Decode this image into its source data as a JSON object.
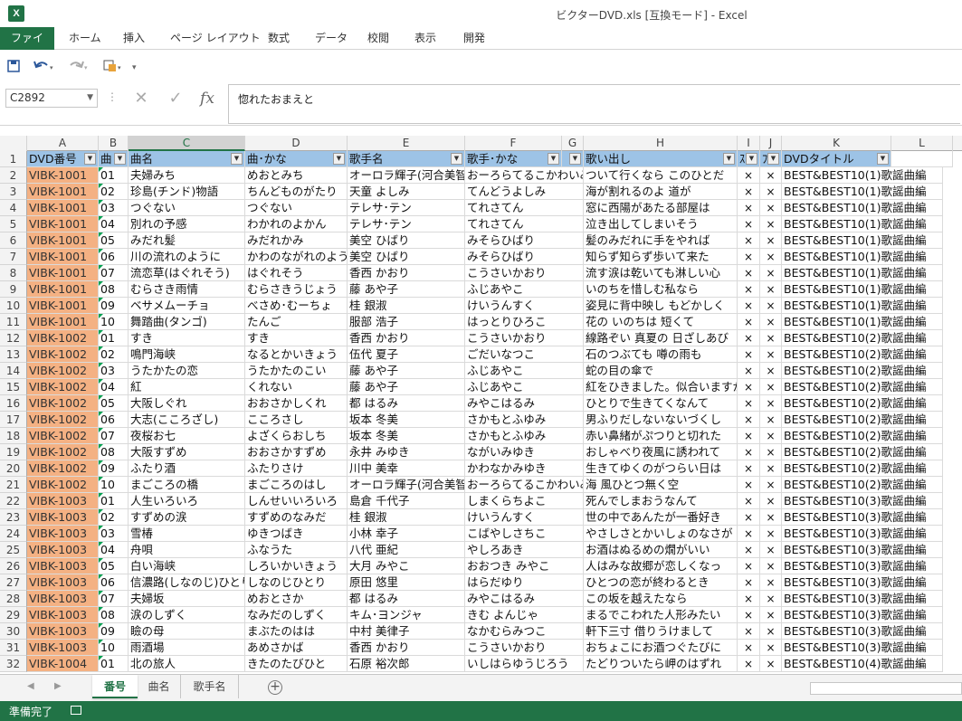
{
  "window": {
    "title": "ビクターDVD.xls  [互換モード] - Excel",
    "app_icon": "X"
  },
  "ribbon": {
    "tabs": [
      "ファイル",
      "ホーム",
      "挿入",
      "ページ レイアウト",
      "数式",
      "データ",
      "校閲",
      "表示",
      "開発"
    ]
  },
  "qat": {
    "icons": [
      "save-icon",
      "undo-icon",
      "redo-icon",
      "format-painter-icon",
      "customize-icon"
    ]
  },
  "formula_bar": {
    "name_box": "C2892",
    "formula": "惚れたおまえと",
    "fx_label": "fx"
  },
  "grid": {
    "columns": [
      "A",
      "B",
      "C",
      "D",
      "E",
      "F",
      "G",
      "H",
      "I",
      "J",
      "K",
      "L",
      "M"
    ],
    "selected_column": "C",
    "header_row": [
      "DVD番号",
      "曲",
      "曲名",
      "曲･かな",
      "歌手名",
      "歌手･かな",
      "",
      "歌い出し",
      "ｽ",
      "ﾌ",
      "DVDタイトル",
      ""
    ],
    "rows": [
      [
        "VIBK-1001",
        "01",
        "夫婦みち",
        "めおとみち",
        "オーロラ輝子(河合美智子)",
        "おーろらてるこかわいみちこ",
        "ついて行くなら このひとだ",
        "×",
        "×",
        "BEST&BEST10(1)歌謡曲編"
      ],
      [
        "VIBK-1001",
        "02",
        "珍島(チンド)物語",
        "ちんどものがたり",
        "天童 よしみ",
        "てんどうよしみ",
        "海が割れるのよ 道が",
        "×",
        "×",
        "BEST&BEST10(1)歌謡曲編"
      ],
      [
        "VIBK-1001",
        "03",
        "つぐない",
        "つぐない",
        "テレサ･テン",
        "てれさてん",
        "窓に西陽があたる部屋は",
        "×",
        "×",
        "BEST&BEST10(1)歌謡曲編"
      ],
      [
        "VIBK-1001",
        "04",
        "別れの予感",
        "わかれのよかん",
        "テレサ･テン",
        "てれさてん",
        "泣き出してしまいそう",
        "×",
        "×",
        "BEST&BEST10(1)歌謡曲編"
      ],
      [
        "VIBK-1001",
        "05",
        "みだれ髪",
        "みだれかみ",
        "美空 ひばり",
        "みそらひばり",
        "髪のみだれに手をやれば",
        "×",
        "×",
        "BEST&BEST10(1)歌謡曲編"
      ],
      [
        "VIBK-1001",
        "06",
        "川の流れのように",
        "かわのながれのように",
        "美空 ひばり",
        "みそらひばり",
        "知らず知らず歩いて来た",
        "×",
        "×",
        "BEST&BEST10(1)歌謡曲編"
      ],
      [
        "VIBK-1001",
        "07",
        "流恋草(はぐれそう)",
        "はぐれそう",
        "香西 かおり",
        "こうさいかおり",
        "流す涙は乾いても淋しい心",
        "×",
        "×",
        "BEST&BEST10(1)歌謡曲編"
      ],
      [
        "VIBK-1001",
        "08",
        "むらさき雨情",
        "むらさきうじょう",
        "藤 あや子",
        "ふじあやこ",
        "いのちを惜しむ私なら",
        "×",
        "×",
        "BEST&BEST10(1)歌謡曲編"
      ],
      [
        "VIBK-1001",
        "09",
        "ベサメムーチョ",
        "べさめ･むーちょ",
        "桂 銀淑",
        "けいうんすく",
        "姿見に背中映し もどかしく",
        "×",
        "×",
        "BEST&BEST10(1)歌謡曲編"
      ],
      [
        "VIBK-1001",
        "10",
        "舞踏曲(タンゴ)",
        "たんご",
        "服部 浩子",
        "はっとりひろこ",
        "花の いのちは 短くて",
        "×",
        "×",
        "BEST&BEST10(1)歌謡曲編"
      ],
      [
        "VIBK-1002",
        "01",
        "すき",
        "すき",
        "香西 かおり",
        "こうさいかおり",
        "線路ぞい 真夏の 日ざしあび",
        "×",
        "×",
        "BEST&BEST10(2)歌謡曲編"
      ],
      [
        "VIBK-1002",
        "02",
        "鳴門海峡",
        "なるとかいきょう",
        "伍代 夏子",
        "ごだいなつこ",
        "石のつぶても 噂の雨も",
        "×",
        "×",
        "BEST&BEST10(2)歌謡曲編"
      ],
      [
        "VIBK-1002",
        "03",
        "うたかたの恋",
        "うたかたのこい",
        "藤 あや子",
        "ふじあやこ",
        "蛇の目の傘で",
        "×",
        "×",
        "BEST&BEST10(2)歌謡曲編"
      ],
      [
        "VIBK-1002",
        "04",
        "紅",
        "くれない",
        "藤 あや子",
        "ふじあやこ",
        "紅をひきました。似合いますか",
        "×",
        "×",
        "BEST&BEST10(2)歌謡曲編"
      ],
      [
        "VIBK-1002",
        "05",
        "大阪しぐれ",
        "おおさかしくれ",
        "都 はるみ",
        "みやこはるみ",
        "ひとりで生きてくなんて",
        "×",
        "×",
        "BEST&BEST10(2)歌謡曲編"
      ],
      [
        "VIBK-1002",
        "06",
        "大志(こころざし)",
        "こころさし",
        "坂本 冬美",
        "さかもとふゆみ",
        "男ふりだしないないづくし",
        "×",
        "×",
        "BEST&BEST10(2)歌謡曲編"
      ],
      [
        "VIBK-1002",
        "07",
        "夜桜お七",
        "よざくらおしち",
        "坂本 冬美",
        "さかもとふゆみ",
        "赤い鼻緒がぷつりと切れた",
        "×",
        "×",
        "BEST&BEST10(2)歌謡曲編"
      ],
      [
        "VIBK-1002",
        "08",
        "大阪すずめ",
        "おおさかすずめ",
        "永井 みゆき",
        "ながいみゆき",
        "おしゃべり夜風に誘われて",
        "×",
        "×",
        "BEST&BEST10(2)歌謡曲編"
      ],
      [
        "VIBK-1002",
        "09",
        "ふたり酒",
        "ふたりさけ",
        "川中 美幸",
        "かわなかみゆき",
        "生きてゆくのがつらい日は",
        "×",
        "×",
        "BEST&BEST10(2)歌謡曲編"
      ],
      [
        "VIBK-1002",
        "10",
        "まごころの橋",
        "まごころのはし",
        "オーロラ輝子(河合美智子)",
        "おーろらてるこかわいみちこ",
        "海 風ひとつ無く空",
        "×",
        "×",
        "BEST&BEST10(2)歌謡曲編"
      ],
      [
        "VIBK-1003",
        "01",
        "人生いろいろ",
        "しんせいいろいろ",
        "島倉 千代子",
        "しまくらちよこ",
        "死んでしまおうなんて",
        "×",
        "×",
        "BEST&BEST10(3)歌謡曲編"
      ],
      [
        "VIBK-1003",
        "02",
        "すずめの涙",
        "すずめのなみだ",
        "桂 銀淑",
        "けいうんすく",
        "世の中であんたが一番好き",
        "×",
        "×",
        "BEST&BEST10(3)歌謡曲編"
      ],
      [
        "VIBK-1003",
        "03",
        "雪椿",
        "ゆきつばき",
        "小林 幸子",
        "こばやしさちこ",
        "やさしさとかいしょのなさが",
        "×",
        "×",
        "BEST&BEST10(3)歌謡曲編"
      ],
      [
        "VIBK-1003",
        "04",
        "舟唄",
        "ふなうた",
        "八代 亜紀",
        "やしろあき",
        "お酒はぬるめの燗がいい",
        "×",
        "×",
        "BEST&BEST10(3)歌謡曲編"
      ],
      [
        "VIBK-1003",
        "05",
        "白い海峡",
        "しろいかいきょう",
        "大月 みやこ",
        "おおつき みやこ",
        "人はみな故郷が恋しくなっ",
        "×",
        "×",
        "BEST&BEST10(3)歌謡曲編"
      ],
      [
        "VIBK-1003",
        "06",
        "信濃路(しなのじ)ひとり",
        "しなのじひとり",
        "原田 悠里",
        "はらだゆり",
        "ひとつの恋が終わるとき",
        "×",
        "×",
        "BEST&BEST10(3)歌謡曲編"
      ],
      [
        "VIBK-1003",
        "07",
        "夫婦坂",
        "めおとさか",
        "都 はるみ",
        "みやこはるみ",
        "この坂を越えたなら",
        "×",
        "×",
        "BEST&BEST10(3)歌謡曲編"
      ],
      [
        "VIBK-1003",
        "08",
        "涙のしずく",
        "なみだのしずく",
        "キム･ヨンジャ",
        "きむ よんじゃ",
        "まるでこわれた人形みたい",
        "×",
        "×",
        "BEST&BEST10(3)歌謡曲編"
      ],
      [
        "VIBK-1003",
        "09",
        "瞼の母",
        "まぶたのはは",
        "中村 美律子",
        "なかむらみつこ",
        "軒下三寸 借りうけまして",
        "×",
        "×",
        "BEST&BEST10(3)歌謡曲編"
      ],
      [
        "VIBK-1003",
        "10",
        "雨酒場",
        "あめさかば",
        "香西 かおり",
        "こうさいかおり",
        "おちょこにお酒つぐたびに",
        "×",
        "×",
        "BEST&BEST10(3)歌謡曲編"
      ],
      [
        "VIBK-1004",
        "01",
        "北の旅人",
        "きたのたびひと",
        "石原 裕次郎",
        "いしはらゆうじろう",
        "たどりついたら岬のはずれ",
        "×",
        "×",
        "BEST&BEST10(4)歌謡曲編"
      ]
    ]
  },
  "sheet_tabs": {
    "tabs": [
      "番号",
      "曲名",
      "歌手名"
    ],
    "active": "番号",
    "add_symbol": "+"
  },
  "status_bar": {
    "text": "準備完了"
  },
  "colors": {
    "excel_green": "#217346",
    "header_fill": "#9dc3e6",
    "dvd_fill": "#f4b183"
  }
}
